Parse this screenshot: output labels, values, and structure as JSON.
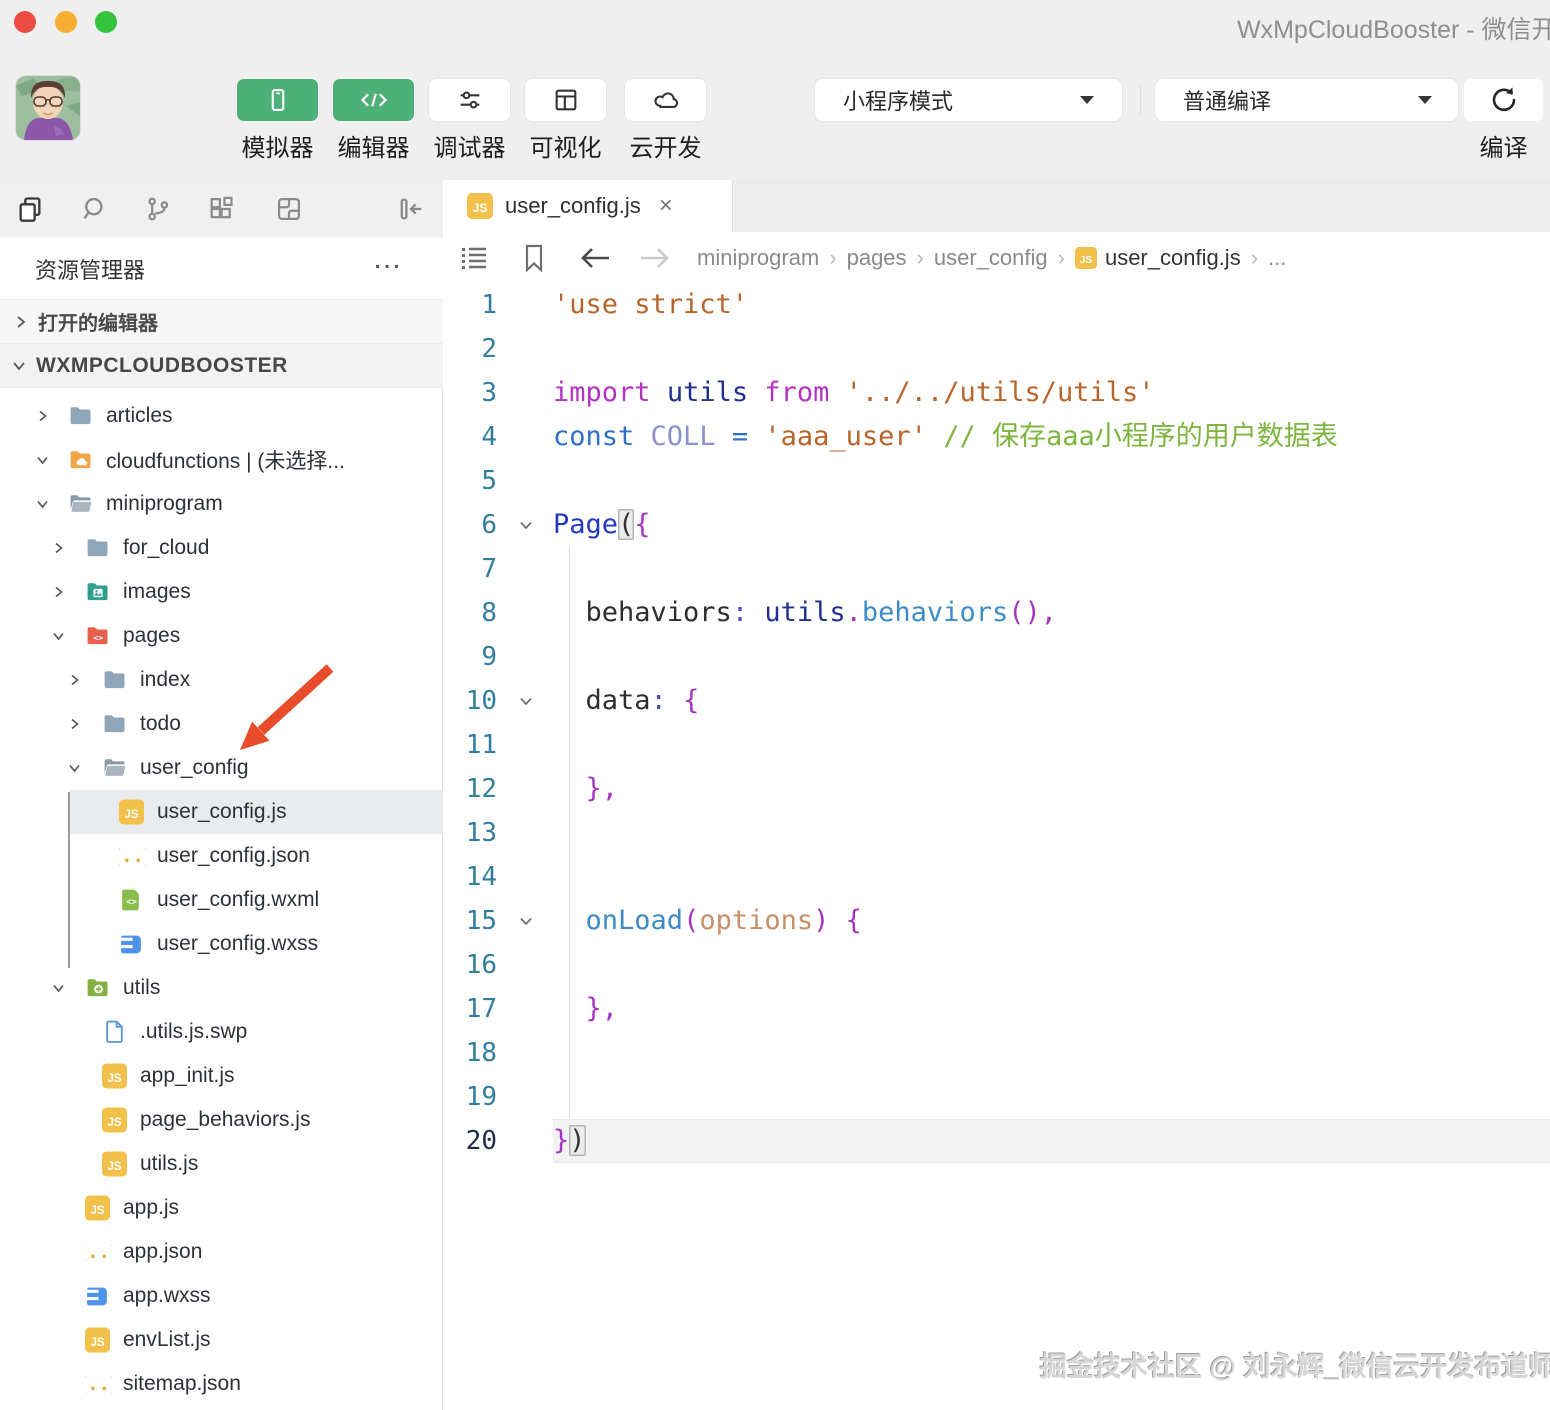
{
  "window": {
    "title": "WxMpCloudBooster - 微信开发者工具"
  },
  "toolbar": {
    "buttons": [
      {
        "label": "模拟器",
        "icon": "phone-icon",
        "style": "green"
      },
      {
        "label": "编辑器",
        "icon": "code-icon",
        "style": "green"
      },
      {
        "label": "调试器",
        "icon": "tune-icon",
        "style": "white"
      },
      {
        "label": "可视化",
        "icon": "layout-icon",
        "style": "white"
      },
      {
        "label": "云开发",
        "icon": "cloud-icon",
        "style": "white"
      }
    ],
    "mode_select": {
      "value": "小程序模式"
    },
    "compile_select": {
      "value": "普通编译"
    },
    "compile_button": {
      "label": "编译"
    }
  },
  "sidebar": {
    "activity_icons": [
      {
        "name": "files-icon",
        "active": true
      },
      {
        "name": "search-icon",
        "active": false
      },
      {
        "name": "source-control-icon",
        "active": false
      },
      {
        "name": "extensions-icon",
        "active": false
      },
      {
        "name": "component-icon",
        "active": false
      },
      {
        "name": "collapse-sidebar-icon",
        "active": false
      }
    ],
    "explorer_title": "资源管理器",
    "more_label": "…",
    "sections": [
      {
        "label": "打开的编辑器",
        "chevron": "right"
      },
      {
        "label": "WXMPCLOUDBOOSTER",
        "chevron": "down"
      }
    ],
    "tree": [
      {
        "label": "articles",
        "level": 1,
        "icon": "folder-blue",
        "chevron": "right"
      },
      {
        "label": "cloudfunctions | (未选择...",
        "level": 1,
        "icon": "folder-cloud",
        "chevron": "down"
      },
      {
        "label": "miniprogram",
        "level": 1,
        "icon": "folder-open",
        "chevron": "down"
      },
      {
        "label": "for_cloud",
        "level": 2,
        "icon": "folder-blue",
        "chevron": "right"
      },
      {
        "label": "images",
        "level": 2,
        "icon": "folder-images",
        "chevron": "right"
      },
      {
        "label": "pages",
        "level": 2,
        "icon": "folder-pages",
        "chevron": "down"
      },
      {
        "label": "index",
        "level": 3,
        "icon": "folder-blue",
        "chevron": "right"
      },
      {
        "label": "todo",
        "level": 3,
        "icon": "folder-blue",
        "chevron": "right"
      },
      {
        "label": "user_config",
        "level": 3,
        "icon": "folder-open",
        "chevron": "down"
      },
      {
        "label": "user_config.js",
        "level": 4,
        "icon": "file-js",
        "selected": true
      },
      {
        "label": "user_config.json",
        "level": 4,
        "icon": "file-json"
      },
      {
        "label": "user_config.wxml",
        "level": 4,
        "icon": "file-wxml"
      },
      {
        "label": "user_config.wxss",
        "level": 4,
        "icon": "file-wxss"
      },
      {
        "label": "utils",
        "level": 2,
        "icon": "folder-utils",
        "chevron": "down"
      },
      {
        "label": ".utils.js.swp",
        "level": 3,
        "icon": "file-generic"
      },
      {
        "label": "app_init.js",
        "level": 3,
        "icon": "file-js"
      },
      {
        "label": "page_behaviors.js",
        "level": 3,
        "icon": "file-js"
      },
      {
        "label": "utils.js",
        "level": 3,
        "icon": "file-js"
      },
      {
        "label": "app.js",
        "level": 2,
        "icon": "file-js"
      },
      {
        "label": "app.json",
        "level": 2,
        "icon": "file-json"
      },
      {
        "label": "app.wxss",
        "level": 2,
        "icon": "file-wxss"
      },
      {
        "label": "envList.js",
        "level": 2,
        "icon": "file-js"
      },
      {
        "label": "sitemap.json",
        "level": 2,
        "icon": "file-json"
      }
    ]
  },
  "editor": {
    "tab": {
      "label": "user_config.js",
      "close": "×"
    },
    "breadcrumb": {
      "items": [
        {
          "label": "miniprogram",
          "type": "folder"
        },
        {
          "label": "pages",
          "type": "folder"
        },
        {
          "label": "user_config",
          "type": "folder"
        },
        {
          "label": "user_config.js",
          "type": "file"
        },
        {
          "label": "...",
          "type": "more"
        }
      ]
    },
    "code": {
      "lines": [
        {
          "n": 1,
          "tokens": [
            [
              "'use strict'",
              "string"
            ]
          ]
        },
        {
          "n": 2,
          "tokens": []
        },
        {
          "n": 3,
          "tokens": [
            [
              "import",
              "kwMagenta"
            ],
            [
              " ",
              ""
            ],
            [
              "utils",
              "ident"
            ],
            [
              " ",
              ""
            ],
            [
              "from",
              "kwMagenta"
            ],
            [
              " ",
              ""
            ],
            [
              "'../../utils/utils'",
              "string"
            ]
          ]
        },
        {
          "n": 4,
          "tokens": [
            [
              "const",
              "kwBlue"
            ],
            [
              " ",
              ""
            ],
            [
              "COLL",
              "constant"
            ],
            [
              " ",
              ""
            ],
            [
              "=",
              "kwBlue"
            ],
            [
              " ",
              ""
            ],
            [
              "'aaa_user'",
              "string"
            ],
            [
              " ",
              ""
            ],
            [
              "// 保存aaa小程序的用户数据表",
              "comment"
            ]
          ]
        },
        {
          "n": 5,
          "tokens": []
        },
        {
          "n": 6,
          "fold": true,
          "tokens": [
            [
              "Page",
              "clazz"
            ],
            [
              "(",
              "boxed"
            ],
            [
              "{",
              "punct"
            ]
          ]
        },
        {
          "n": 7,
          "tokens": []
        },
        {
          "n": 8,
          "tokens": [
            [
              "  ",
              ""
            ],
            [
              "behaviors",
              "prop"
            ],
            [
              ":",
              "colon"
            ],
            [
              " ",
              ""
            ],
            [
              "utils",
              "ident"
            ],
            [
              ".",
              "punct"
            ],
            [
              "behaviors",
              "method"
            ],
            [
              "(",
              "punct"
            ],
            [
              ")",
              "punct"
            ],
            [
              ",",
              "punct"
            ]
          ]
        },
        {
          "n": 9,
          "tokens": []
        },
        {
          "n": 10,
          "fold": true,
          "tokens": [
            [
              "  ",
              ""
            ],
            [
              "data",
              "prop"
            ],
            [
              ":",
              "colon"
            ],
            [
              " ",
              ""
            ],
            [
              "{",
              "punct"
            ]
          ]
        },
        {
          "n": 11,
          "tokens": []
        },
        {
          "n": 12,
          "tokens": [
            [
              "  ",
              ""
            ],
            [
              "}",
              "punct"
            ],
            [
              ",",
              "punct"
            ]
          ]
        },
        {
          "n": 13,
          "tokens": []
        },
        {
          "n": 14,
          "tokens": []
        },
        {
          "n": 15,
          "fold": true,
          "tokens": [
            [
              "  ",
              ""
            ],
            [
              "onLoad",
              "method"
            ],
            [
              "(",
              "punct"
            ],
            [
              "options",
              "param"
            ],
            [
              ")",
              "punct"
            ],
            [
              " ",
              ""
            ],
            [
              "{",
              "punct"
            ]
          ]
        },
        {
          "n": 16,
          "tokens": []
        },
        {
          "n": 17,
          "tokens": [
            [
              "  ",
              ""
            ],
            [
              "}",
              "punct"
            ],
            [
              ",",
              "punct"
            ]
          ]
        },
        {
          "n": 18,
          "tokens": []
        },
        {
          "n": 19,
          "tokens": []
        },
        {
          "n": 20,
          "active": true,
          "tokens": [
            [
              "}",
              "punct"
            ],
            [
              ")",
              "boxed"
            ]
          ]
        }
      ]
    }
  },
  "watermark": {
    "text": "掘金技术社区 @ 刘永辉_微信云开发布道师"
  },
  "colors": {
    "traffic": [
      "#ED4C42",
      "#F5AE32",
      "#35C33B"
    ],
    "accent_green": "#4DB078",
    "arrow_red": "#E84C2B",
    "syntax": {
      "string": "#B9642A",
      "kwMagenta": "#B433C3",
      "ident": "#20308F",
      "kwBlue": "#2E70C8",
      "constant": "#8A91CC",
      "comment": "#7DB63E",
      "prop": "#2E2E2E",
      "colon": "#4B4FC9",
      "method": "#3E8CC7",
      "param": "#C89069",
      "punct": "#A632C3",
      "clazz": "#2438C0",
      "boxed": "#333333"
    }
  }
}
